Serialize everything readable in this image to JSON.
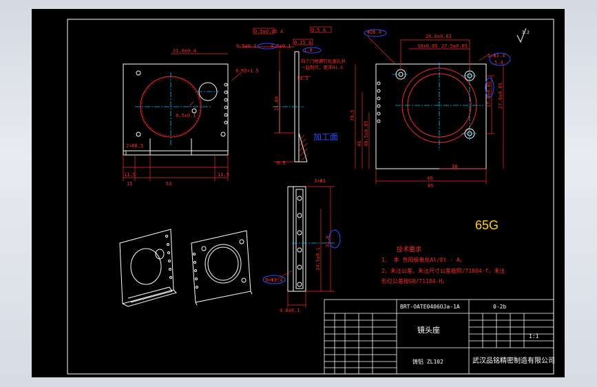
{
  "colors": {
    "background": "#000000",
    "frame": "#ffffff",
    "dimension": "#ff2a2a",
    "centerline": "#00c8ff",
    "part": "#ffffff",
    "note": "#ff2a2a",
    "highlight": "#2e4cff",
    "material_tag": "#ffd400"
  },
  "material_tag": "65G",
  "front_view": {
    "dims": [
      "31.0±0.4",
      "8.5±0.1",
      "8-M3×1.5",
      "2×R0.5",
      "11.5",
      "15",
      "53",
      "11.5"
    ]
  },
  "side_view": {
    "callouts": [
      "0.5±0.05 A",
      "0.5 A",
      "0.15 A",
      "4.5±0.1",
      "0.5±0.1",
      "1.0"
    ],
    "note_line1": "四个门框螺钉检查孔并",
    "note_line2": "一起制作，要求H1.6",
    "dims": [
      "10.5",
      "21.00",
      "0.5"
    ],
    "process_mark": "加工面"
  },
  "top_view": {
    "dims": [
      "Φ26.4",
      "26.0±0.02",
      "10±0.05",
      "27.5±0.05",
      "3×Φ3.4",
      "5.4",
      "17.0±0.05",
      "27.0±0.05",
      "46",
      "70.5",
      "85",
      "40.5±0.05",
      "30",
      "49"
    ]
  },
  "bottom_view": {
    "dims": [
      "3×Φ3",
      "31.0",
      "34.5±0.1",
      "4.8±0.1"
    ],
    "callout": "8×Φ3.4"
  },
  "tech_req": {
    "title": "技术要求",
    "line1": "1、 本  色阳极氧化Al/Et · A。",
    "line2": "2、未注公差，未注尺寸公差按照/T1804-f，未注",
    "line3": "形位公差按GB/T1184-H。"
  },
  "title_block": {
    "drawing_no": "BRT-OATE0406OJa-1A",
    "rev": "0-2b",
    "part_name": "镜头座",
    "material": "铸铝 ZL102",
    "company": "武汉品铭精密制造有限公司",
    "scale": "1:1"
  }
}
